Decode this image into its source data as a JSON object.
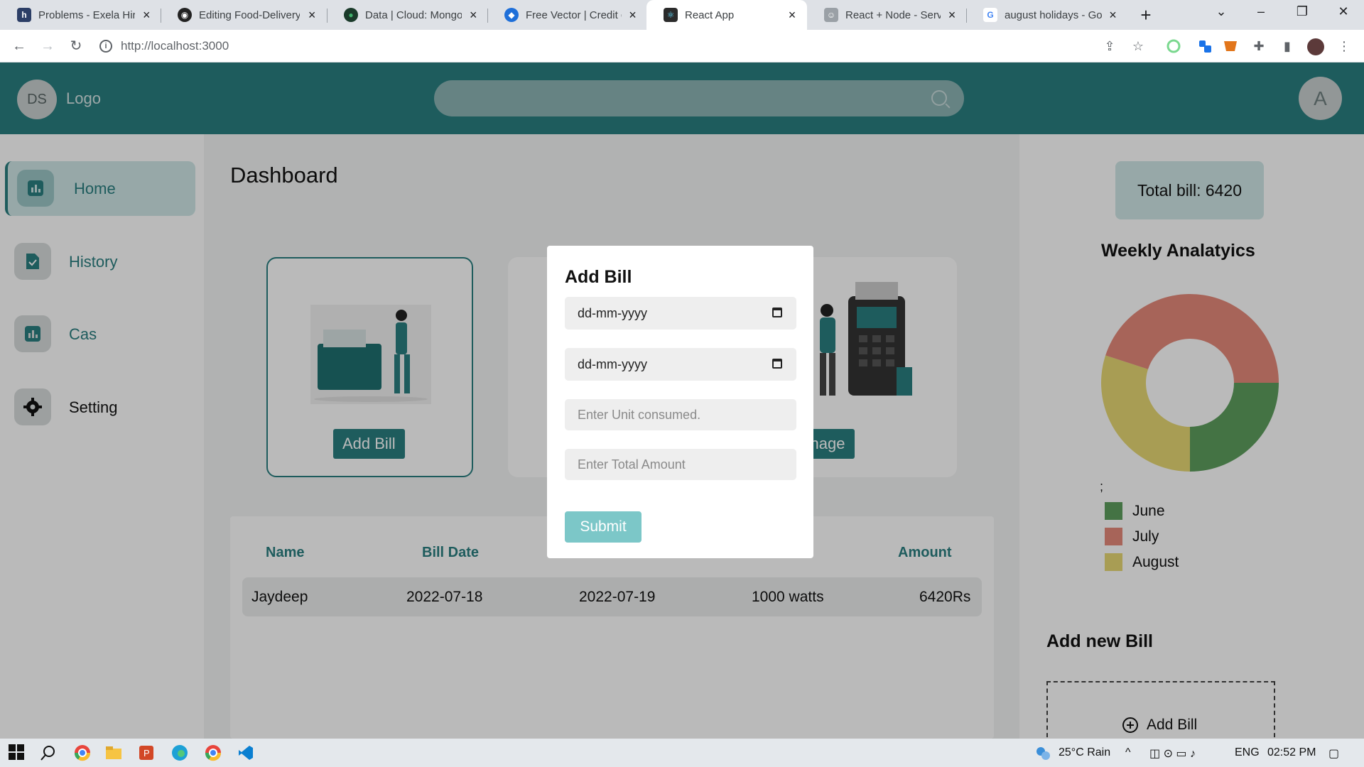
{
  "browser": {
    "tabs": [
      {
        "title": "Problems - Exela Hiring",
        "fav_text": "h",
        "fav_color": "#2c3e66"
      },
      {
        "title": "Editing Food-Delivery",
        "fav_text": "◉",
        "fav_color": "#222222"
      },
      {
        "title": "Data | Cloud: MongoDB",
        "fav_text": "●",
        "fav_color": "#1a3a2a"
      },
      {
        "title": "Free Vector | Credit card",
        "fav_text": "◆",
        "fav_color": "#1e6fd9"
      },
      {
        "title": "React App",
        "fav_text": "⚛",
        "fav_color": "#2b2b2b"
      },
      {
        "title": "React + Node - Server",
        "fav_text": "☺",
        "fav_color": "#9aa0a6"
      },
      {
        "title": "august holidays - Google",
        "fav_text": "G",
        "fav_color": "#ffffff"
      }
    ],
    "active_tab_index": 4,
    "new_tab": "+",
    "url": "http://localhost:3000"
  },
  "app": {
    "header": {
      "initials": "DS",
      "logo": "Logo",
      "search_placeholder": "",
      "user_initial": "A"
    },
    "sidebar": {
      "items": [
        {
          "label": "Home",
          "icon": "bar-chart-icon",
          "active": true
        },
        {
          "label": "History",
          "icon": "file-check-icon",
          "active": false
        },
        {
          "label": "Cas",
          "icon": "bar-chart-icon",
          "active": false
        },
        {
          "label": "Setting",
          "icon": "gear-icon",
          "active": false
        }
      ]
    },
    "main": {
      "title": "Dashboard",
      "cards": [
        {
          "button": "Add Bill"
        },
        {
          "button": ""
        },
        {
          "button": "Manage"
        }
      ],
      "table": {
        "headers": [
          "Name",
          "Bill Date",
          "",
          "",
          "Amount"
        ],
        "rows": [
          {
            "name": "Jaydeep",
            "bill_date": "2022-07-18",
            "due_date": "2022-07-19",
            "units": "1000 watts",
            "amount": "6420Rs"
          }
        ]
      }
    },
    "right": {
      "total_bill": "Total bill: 6420",
      "chart_title": "Weekly Analatyics",
      "stray_text": ";",
      "legend": [
        {
          "label": "June",
          "color": "#5e9e5e"
        },
        {
          "label": "July",
          "color": "#e58a7a"
        },
        {
          "label": "August",
          "color": "#e6d874"
        }
      ],
      "add_new_title": "Add new Bill",
      "add_new_button": "Add Bill"
    },
    "modal": {
      "title": "Add Bill",
      "date1_placeholder": "dd-mm-yyyy",
      "date2_placeholder": "dd-mm-yyyy",
      "units_placeholder": "Enter Unit consumed.",
      "amount_placeholder": "Enter Total Amount",
      "submit": "Submit"
    }
  },
  "chart_data": {
    "type": "pie",
    "title": "Weekly Analatyics",
    "categories": [
      "June",
      "July",
      "August"
    ],
    "values": [
      25,
      45,
      30
    ],
    "colors": [
      "#5e9e5e",
      "#e58a7a",
      "#e6d874"
    ],
    "donut": true,
    "legend": "bottom-left"
  },
  "taskbar": {
    "weather": "25°C  Rain",
    "language": "ENG",
    "time": "02:52 PM"
  }
}
